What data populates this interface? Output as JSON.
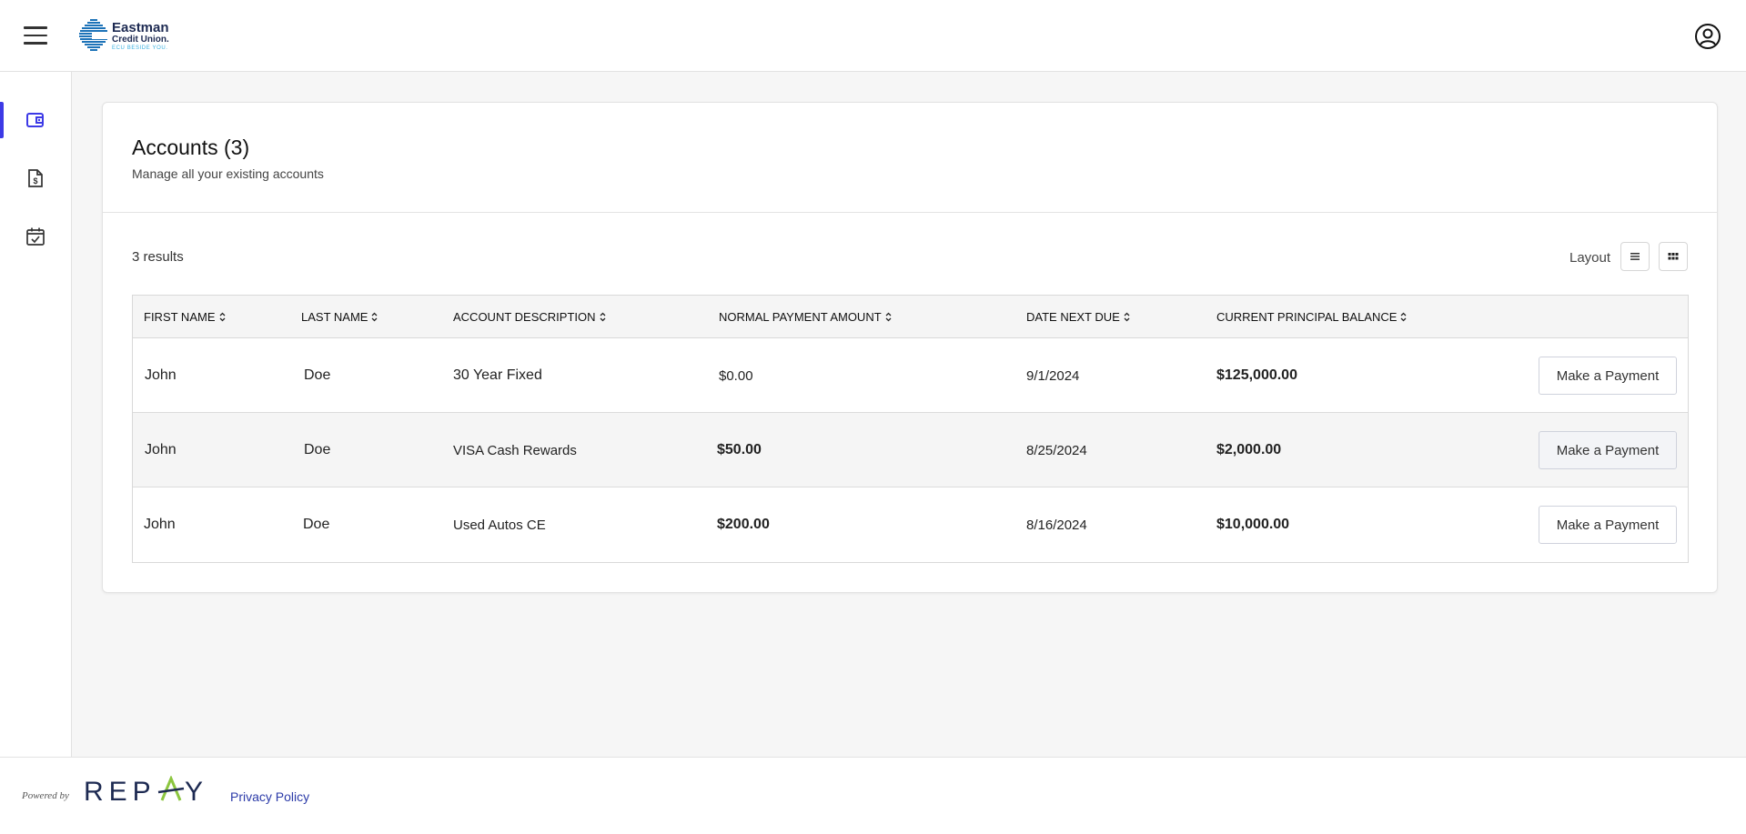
{
  "brand": {
    "name": "Eastman",
    "sub": "Credit Union.",
    "tagline": "ECU BESIDE YOU.",
    "accent": "#3d3ae6"
  },
  "header": {
    "menu_icon": "hamburger-menu-icon",
    "user_icon": "user-circle-icon"
  },
  "sidebar": {
    "items": [
      {
        "icon": "wallet-icon",
        "active": true
      },
      {
        "icon": "document-dollar-icon",
        "active": false
      },
      {
        "icon": "calendar-check-icon",
        "active": false
      }
    ]
  },
  "accounts": {
    "title": "Accounts (3)",
    "subtitle": "Manage all your existing accounts",
    "results": "3 results",
    "layout_label": "Layout",
    "columns": [
      "FIRST NAME",
      "LAST NAME",
      "ACCOUNT DESCRIPTION",
      "NORMAL PAYMENT AMOUNT",
      "DATE NEXT DUE",
      "CURRENT PRINCIPAL BALANCE"
    ],
    "rows": [
      {
        "first": "John",
        "last": "Doe",
        "description": "30 Year Fixed",
        "payment": "$0.00",
        "due": "9/1/2024",
        "balance": "$125,000.00",
        "action": "Make a Payment"
      },
      {
        "first": "John",
        "last": "Doe",
        "description": "VISA Cash Rewards",
        "payment": "$50.00",
        "due": "8/25/2024",
        "balance": "$2,000.00",
        "action": "Make a Payment"
      },
      {
        "first": "John",
        "last": "Doe",
        "description": "Used Autos CE",
        "payment": "$200.00",
        "due": "8/16/2024",
        "balance": "$10,000.00",
        "action": "Make a Payment"
      }
    ]
  },
  "footer": {
    "powered_by": "Powered by",
    "provider": "REPAY",
    "privacy": "Privacy Policy"
  }
}
